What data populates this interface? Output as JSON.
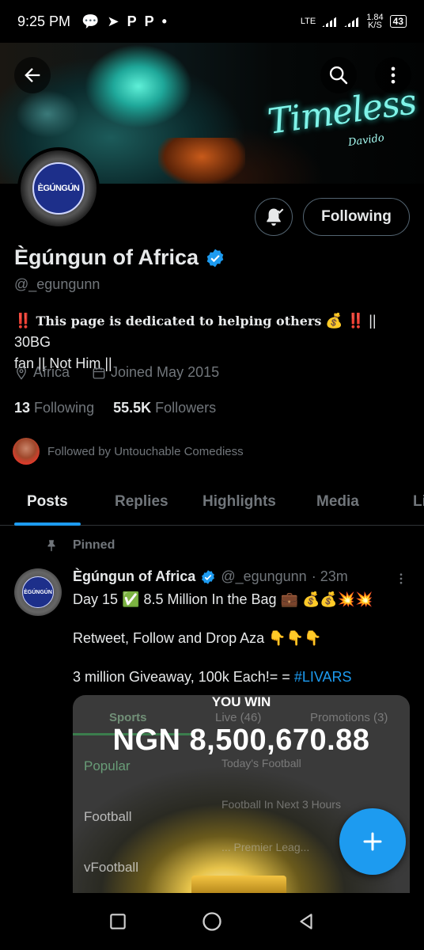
{
  "status_bar": {
    "time": "9:25 PM",
    "notif_icons": [
      "chat-bubble-icon",
      "telegram-icon",
      "p-icon",
      "p-icon",
      "dot-icon"
    ],
    "network": "LTE",
    "speed": "1.84",
    "speed_unit": "K/S",
    "battery": "43"
  },
  "banner": {
    "script_text": "Timeless",
    "script_sub": "Davido"
  },
  "profile": {
    "avatar_text": "ÈGÚNGÚN",
    "follow_button": "Following",
    "name": "Ègúngun of Africa",
    "handle": "@_egungunn",
    "bio_marks": "‼️",
    "bio_bold": "This page is dedicated to helping others",
    "bio_money": "💰",
    "bio_rest_line1": " || 30BG",
    "bio_line2": "fan || Not Him ||",
    "location": "Africa",
    "joined": "Joined May 2015",
    "following_count": "13",
    "following_label": "Following",
    "followers_count": "55.5K",
    "followers_label": "Followers",
    "followed_by": "Followed by Untouchable Comediess"
  },
  "tabs": [
    {
      "label": "Posts",
      "active": true
    },
    {
      "label": "Replies",
      "active": false
    },
    {
      "label": "Highlights",
      "active": false
    },
    {
      "label": "Media",
      "active": false
    },
    {
      "label": "Li",
      "active": false
    }
  ],
  "post": {
    "pinned_label": "Pinned",
    "author": "Ègúngun of Africa",
    "handle": "@_egungunn",
    "time": "· 23m",
    "line1": "Day 15 ✅ 8.5 Million In the Bag 💼 💰💰💥💥",
    "line2": "Retweet, Follow and Drop Aza 👇👇👇",
    "line3_prefix": "3 million Giveaway, 100k Each!= = ",
    "hashtag": "#LIVARS",
    "media": {
      "tab_sports": "Sports",
      "tab_live": "Live (46)",
      "tab_promotions": "Promotions (3)",
      "you_win": "YOU WIN",
      "amount": "NGN 8,500,670.88",
      "left_items": [
        "Popular",
        "Football",
        "vFootball"
      ],
      "right_items": [
        "Today's Football",
        "Football In Next 3 Hours",
        "... Premier Leag..."
      ]
    }
  },
  "colors": {
    "accent": "#1d9bf0",
    "background": "#000000",
    "secondary_text": "#71767b",
    "primary_text": "#e7e9ea"
  }
}
